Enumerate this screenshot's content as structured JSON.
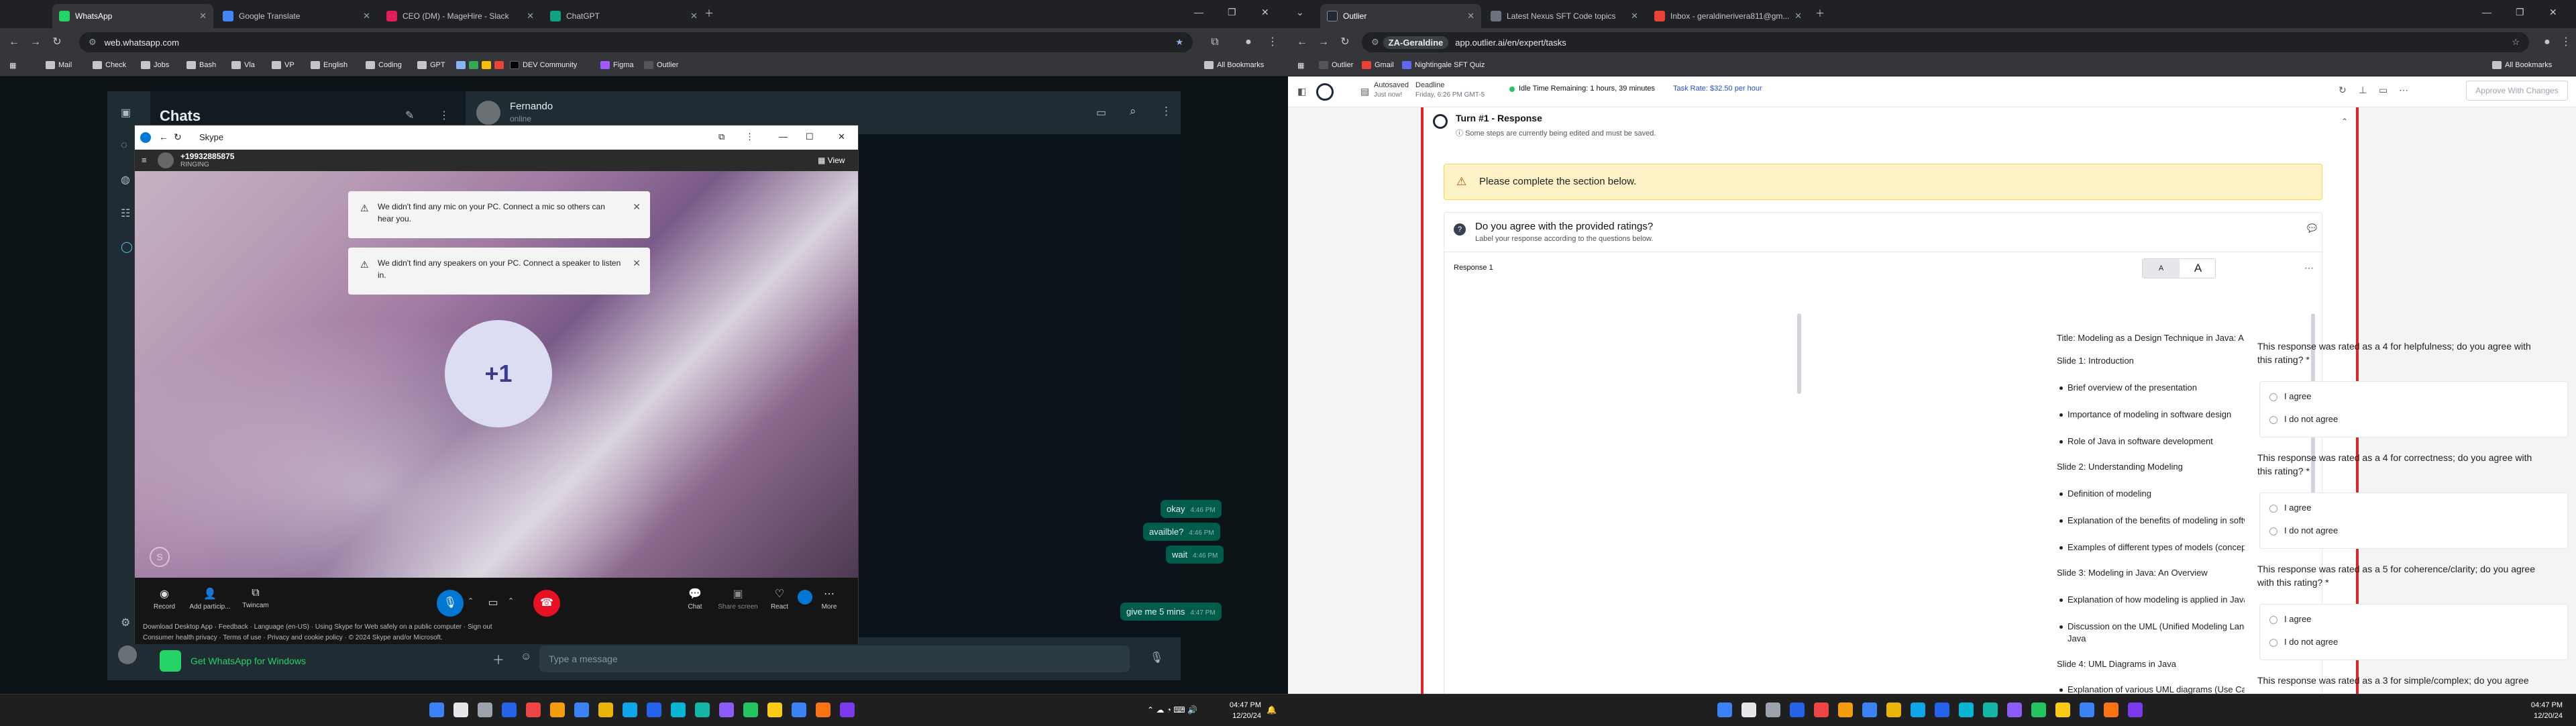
{
  "left_browser": {
    "tabs": [
      {
        "title": "WhatsApp",
        "color": "#25d366",
        "active": true
      },
      {
        "title": "Google Translate",
        "color": "#4285f4"
      },
      {
        "title": "CEO (DM) - MageHire - Slack",
        "color": "#e01e5a"
      },
      {
        "title": "ChatGPT",
        "color": "#10a37f"
      }
    ],
    "url": "web.whatsapp.com",
    "bookmarks": [
      "Mail",
      "Check",
      "Jobs",
      "Bash",
      "Vla",
      "VP",
      "English",
      "Coding",
      "GPT",
      "DEV Community",
      "Figma",
      "Outlier"
    ],
    "all_bookmarks": "All Bookmarks"
  },
  "whatsapp": {
    "chats_title": "Chats",
    "contact_name": "Fernando",
    "contact_status": "online",
    "messages": [
      {
        "text": "okay",
        "time": "4:46 PM"
      },
      {
        "text": "availble?",
        "time": "4:46 PM"
      },
      {
        "text": "wait",
        "time": "4:46 PM"
      },
      {
        "text": "give me 5 mins",
        "time": "4:47 PM"
      }
    ],
    "input_placeholder": "Type a message",
    "get_windows": "Get WhatsApp for Windows"
  },
  "skype": {
    "window_title": "Skype",
    "caller_number": "+19932885875",
    "call_status": "RINGING",
    "view_label": "View",
    "notices": [
      "We didn't find any mic on your PC. Connect a mic so others can hear you.",
      "We didn't find any speakers on your PC. Connect a speaker to listen in."
    ],
    "avatar_label": "+1",
    "controls": {
      "record": "Record",
      "add_participants": "Add particip...",
      "twincam": "Twincam",
      "chat": "Chat",
      "share_screen": "Share screen",
      "react": "React",
      "more": "More"
    },
    "footer_links": [
      "Download Desktop App",
      "Feedback",
      "Language (en-US)",
      "Using Skype for Web safely on a public computer",
      "Sign out"
    ],
    "footer_links2": [
      "Consumer health privacy",
      "Terms of use",
      "Privacy and cookie policy",
      "© 2024 Skype and/or Microsoft."
    ]
  },
  "right_browser": {
    "tabs": [
      {
        "title": "Outlier",
        "color": "#1f2937",
        "active": true
      },
      {
        "title": "Latest Nexus SFT Code topics",
        "color": "#6b7280"
      },
      {
        "title": "Inbox - geraldinerivera811@gm...",
        "color": "#ea4335"
      }
    ],
    "url_profile": "ZA-Geraldine",
    "url": "app.outlier.ai/en/expert/tasks",
    "bookmarks": [
      "Outlier",
      "Gmail",
      "Nightingale SFT Quiz"
    ],
    "all_bookmarks": "All Bookmarks"
  },
  "outlier": {
    "autosaved": "Autosaved",
    "autosaved_when": "Just now!",
    "deadline_label": "Deadline",
    "deadline_value": "Friday, 6:26 PM GMT-5",
    "idle_time": "Idle Time Remaining: 1 hours, 39 minutes",
    "task_rate": "Task Rate: $32.50 per hour",
    "approve_button": "Approve With Changes",
    "turn_title": "Turn #1 - Response",
    "turn_subtitle": "Some steps are currently being edited and must be saved.",
    "alert": "Please complete the section below.",
    "section_title": "Do you agree with the provided ratings?",
    "section_subtitle": "Label your response according to the questions below.",
    "response_label": "Response 1",
    "font_small": "A",
    "font_large": "A",
    "document": [
      {
        "text": "Title: Modeling as a Design Technique in Java: A Comprehensive Approach",
        "bullet": false
      },
      {
        "text": "Slide 1: Introduction",
        "bullet": false
      },
      {
        "text": "Brief overview of the presentation",
        "bullet": true
      },
      {
        "text": "Importance of modeling in software design",
        "bullet": true
      },
      {
        "text": "Role of Java in software development",
        "bullet": true
      },
      {
        "text": "Slide 2: Understanding Modeling",
        "bullet": false
      },
      {
        "text": "Definition of modeling",
        "bullet": true
      },
      {
        "text": "Explanation of the benefits of modeling in software design",
        "bullet": true
      },
      {
        "text": "Examples of different types of models (conceptual, logical, physical)",
        "bullet": true
      },
      {
        "text": "Slide 3: Modeling in Java: An Overview",
        "bullet": false
      },
      {
        "text": "Explanation of how modeling is applied in Java",
        "bullet": true
      },
      {
        "text": "Discussion on the UML (Unified Modeling Language) and its relevance in",
        "bullet": true
      },
      {
        "text": "Java",
        "bullet": false,
        "cont": true
      },
      {
        "text": "Slide 4: UML Diagrams in Java",
        "bullet": false
      },
      {
        "text": "Explanation of various UML diagrams (Use Case, Class, Sequence, Activity",
        "bullet": true
      }
    ],
    "questions": [
      {
        "line1": "This response was rated as a 4 for helpfulness; do you agree with",
        "line2": "this rating? *"
      },
      {
        "line1": "This response was rated as a 4 for correctness; do you agree with",
        "line2": "this rating? *"
      },
      {
        "line1": "This response was rated as a 5 for coherence/clarity; do you agree",
        "line2": "with this rating? *"
      },
      {
        "line1": "This response was rated as a 3 for simple/complex; do you agree",
        "line2": ""
      }
    ],
    "option_agree": "I agree",
    "option_disagree": "I do not agree"
  },
  "taskbar": {
    "time": "04:47 PM",
    "date": "12/20/24",
    "time_right": "04:47 PM",
    "date_right": "12/20/24"
  },
  "colors": {
    "whatsapp_green": "#25d366",
    "outgoing_bubble": "#005c4b",
    "skype_blue": "#0078d4",
    "end_call_red": "#e81123",
    "outlier_accent": "#dc2626",
    "alert_bg": "#fef3c7"
  }
}
